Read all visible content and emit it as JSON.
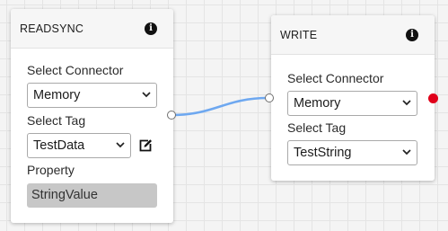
{
  "nodes": {
    "readsync": {
      "title": "READSYNC",
      "icon": "info-icon",
      "connector_label": "Select Connector",
      "connector_value": "Memory",
      "tag_label": "Select Tag",
      "tag_value": "TestData",
      "tag_edit_icon": "edit-icon",
      "property_label": "Property",
      "property_value": "StringValue"
    },
    "write": {
      "title": "WRITE",
      "icon": "info-icon",
      "connector_label": "Select Connector",
      "connector_value": "Memory",
      "tag_label": "Select Tag",
      "tag_value": "TestString"
    }
  },
  "icons": {
    "info_glyph": "i",
    "chevron": "chevron-down-icon"
  },
  "colors": {
    "wire": "#6ea8f0",
    "status_dot": "#e0001a",
    "readonly_bg": "#c7c7c7",
    "grid": "#e4e4e4"
  }
}
